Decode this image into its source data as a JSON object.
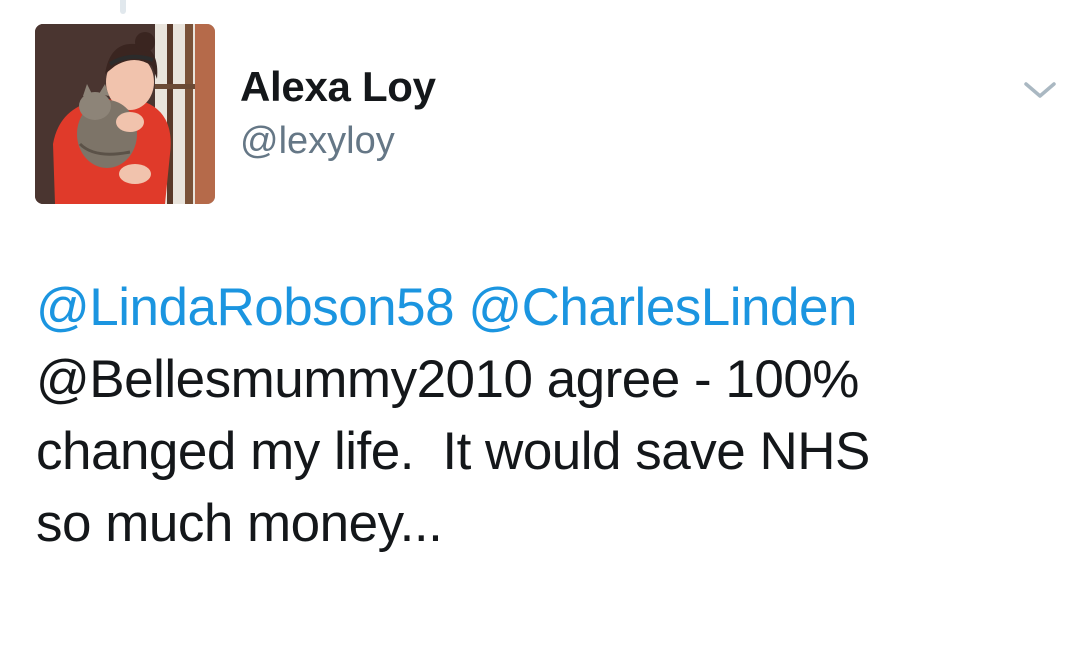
{
  "tweet": {
    "author": {
      "display_name": "Alexa Loy",
      "handle": "@lexyloy",
      "avatar_icon": "profile-photo-avatar"
    },
    "menu_icon": "chevron-down-icon",
    "text_lines": [
      {
        "parts": [
          {
            "type": "mention",
            "text": "@LindaRobson58"
          },
          {
            "type": "text",
            "text": " "
          },
          {
            "type": "mention",
            "text": "@CharlesLinden"
          }
        ]
      },
      {
        "parts": [
          {
            "type": "text",
            "text": "@Bellesmummy2010 agree - 100%"
          }
        ]
      },
      {
        "parts": [
          {
            "type": "text",
            "text": "changed my life.  It would save NHS"
          }
        ]
      },
      {
        "parts": [
          {
            "type": "text",
            "text": "so much money..."
          }
        ]
      }
    ],
    "colors": {
      "mention": "#1b95e0",
      "text": "#14171a",
      "handle": "#657786",
      "caret": "#aab8c2"
    }
  }
}
